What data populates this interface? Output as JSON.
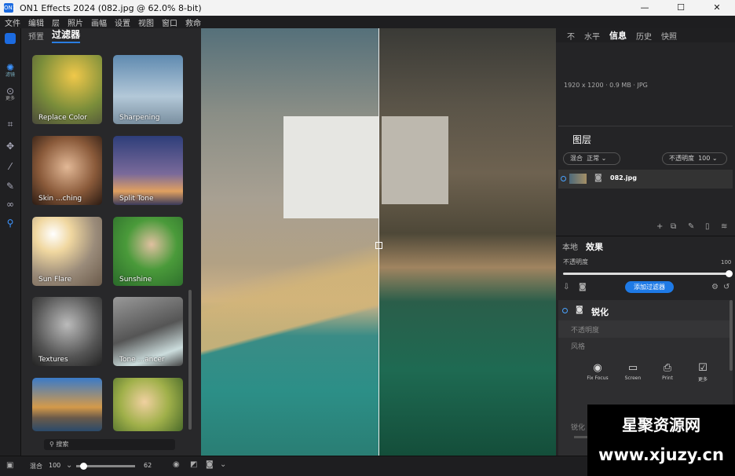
{
  "window": {
    "title": "ON1 Effects 2024 (082.jpg @ 62.0% 8-bit)",
    "app_icon": "ON1",
    "min": "—",
    "max": "☐",
    "close": "✕"
  },
  "menu": [
    "文件",
    "编辑",
    "层",
    "照片",
    "画幅",
    "设置",
    "视图",
    "窗口",
    "救命"
  ],
  "toolstrip": {
    "filters_label": "滤镜",
    "more_label": "更多"
  },
  "left_panel": {
    "tabs": [
      "预置",
      "过滤器"
    ],
    "tiles": [
      {
        "label": "Replace Color"
      },
      {
        "label": "Sharpening"
      },
      {
        "label": "Skin ...ching"
      },
      {
        "label": "Split Tone"
      },
      {
        "label": "Sun Flare"
      },
      {
        "label": "Sunshine"
      },
      {
        "label": "Textures"
      },
      {
        "label": "Tone ...ancer"
      },
      {
        "label": ""
      },
      {
        "label": ""
      }
    ],
    "search_placeholder": "搜索"
  },
  "right_panel": {
    "tabs": [
      "不",
      "水平",
      "信息",
      "历史",
      "快照"
    ],
    "info_line": "1920 x 1200 · 0.9 MB · JPG",
    "layers_title": "图层",
    "blend_label": "混合",
    "blend_value": "正常",
    "opacity_label": "不透明度",
    "opacity_value": "100",
    "layer_name": "082.jpg",
    "fx_tabs": [
      "本地",
      "效果"
    ],
    "fx_opacity_label": "不透明度",
    "fx_opacity_value": "100",
    "add_filter": "添加过滤器",
    "filter_name": "锐化",
    "filter_opacity_label": "不透明度",
    "style_label": "风格",
    "presets": [
      "Fix Focus",
      "Screen",
      "Print",
      "更多"
    ],
    "sharpen_label": "锐化"
  },
  "bottom_bar": {
    "blend_label": "混合",
    "opacity_value": "100",
    "zoom_value": "62",
    "brush_value": "0.62"
  },
  "watermark": {
    "line1": "星聚资源网",
    "line2": "www.xjuzy.cn"
  }
}
